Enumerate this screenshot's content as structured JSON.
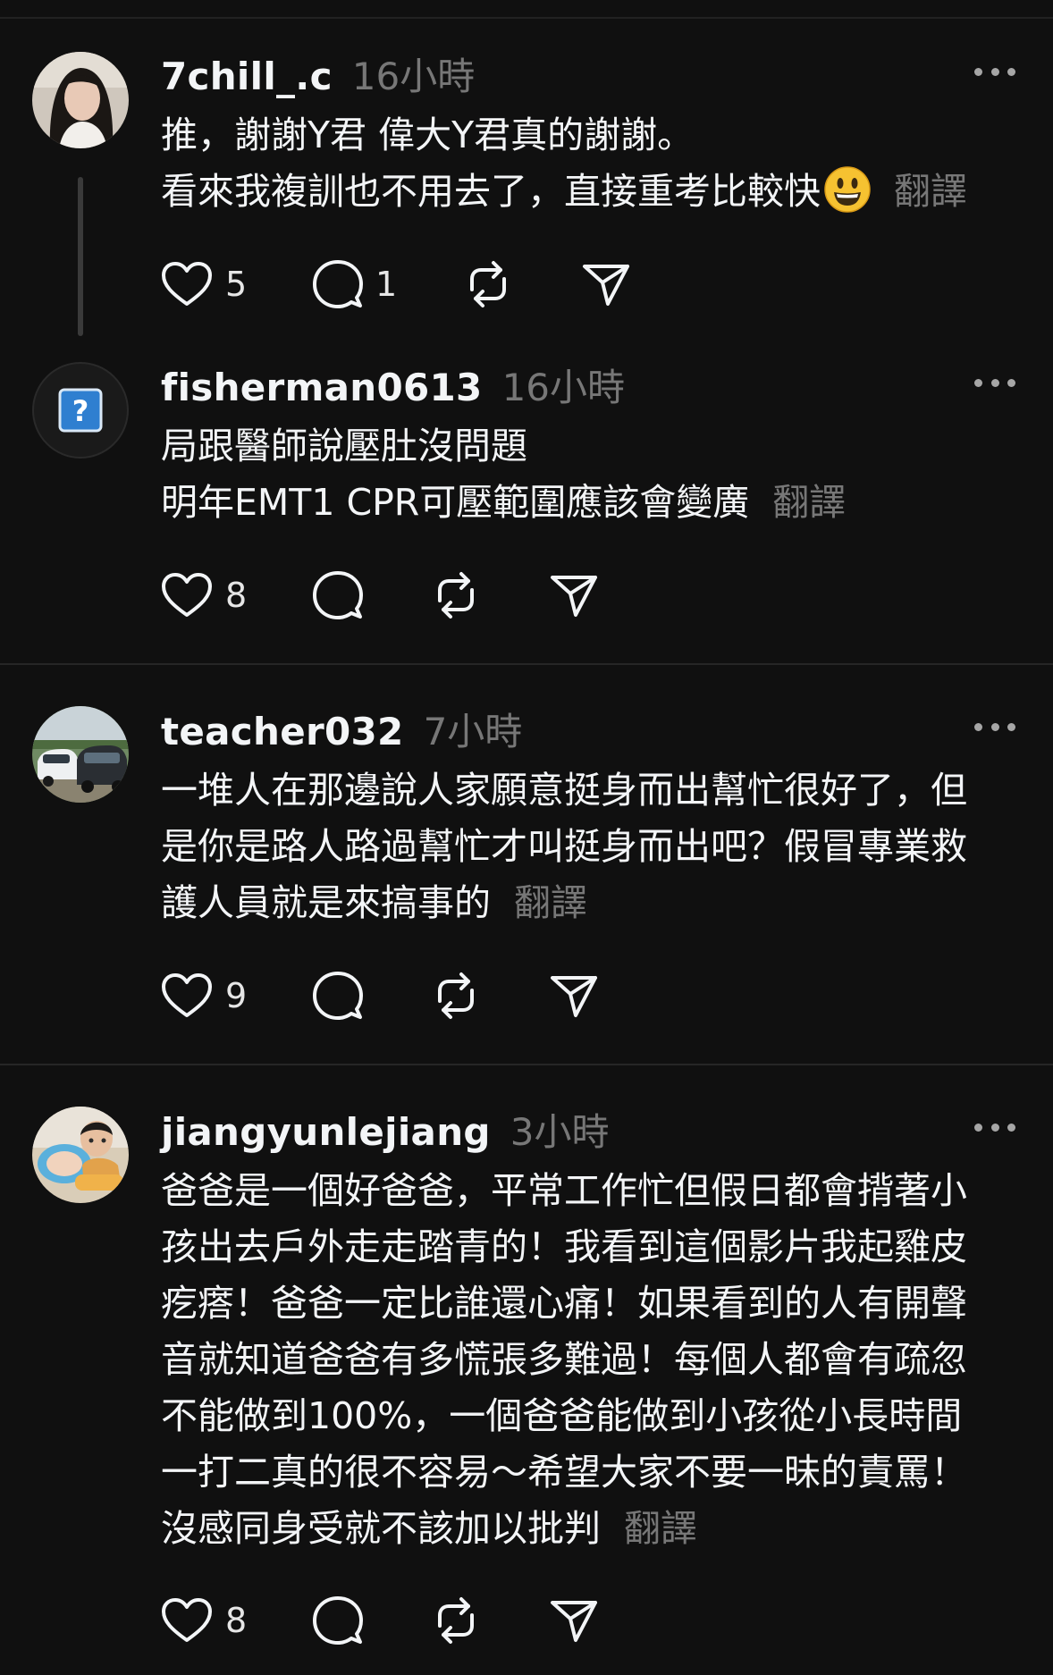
{
  "posts": [
    {
      "username": "7chill_.c",
      "time": "16小時",
      "lines": [
        "推，謝謝Y君 偉大Y君真的謝謝。",
        "看來我複訓也不用去了，直接重考比較快"
      ],
      "emoji": "grinning-face-emoji",
      "translate": "翻譯",
      "likes": "5",
      "replies": "1",
      "avatar": "woman-photo"
    },
    {
      "username": "fisherman0613",
      "time": "16小時",
      "lines": [
        "局跟醫師說壓肚沒問題",
        "明年EMT1 CPR可壓範圍應該會變廣"
      ],
      "translate": "翻譯",
      "likes": "8",
      "avatar": "question-mark-icon"
    },
    {
      "username": "teacher032",
      "time": "7小時",
      "lines": [
        "一堆人在那邊說人家願意挺身而出幫忙很好了，但",
        "是你是路人路過幫忙才叫挺身而出吧？假冒專業救",
        "護人員就是來搞事的"
      ],
      "translate": "翻譯",
      "likes": "9",
      "avatar": "cars-photo"
    },
    {
      "username": "jiangyunlejiang",
      "time": "3小時",
      "lines": [
        "爸爸是一個好爸爸，平常工作忙但假日都會揹著小",
        "孩出去戶外走走踏青的！我看到這個影片我起雞皮",
        "疙瘩！爸爸一定比誰還心痛！如果看到的人有開聲",
        "音就知道爸爸有多慌張多難過！每個人都會有疏忽",
        "不能做到100%，一個爸爸能做到小孩從小長時間",
        "一打二真的很不容易～希望大家不要一昧的責罵！",
        "沒感同身受就不該加以批判"
      ],
      "translate": "翻譯",
      "likes": "8",
      "avatar": "children-photo"
    }
  ],
  "icons": {
    "like": "heart-icon",
    "reply": "comment-icon",
    "repost": "repost-icon",
    "share": "send-icon",
    "more": "more-icon"
  }
}
